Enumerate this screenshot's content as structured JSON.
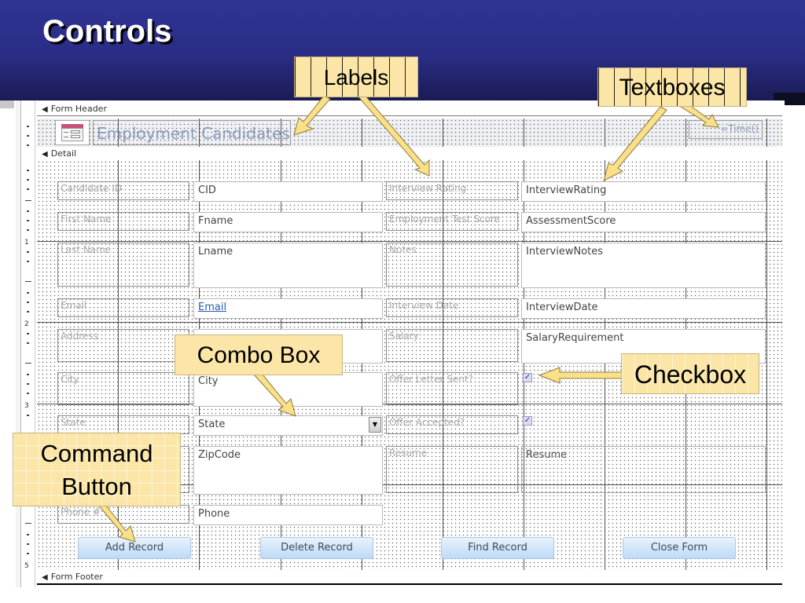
{
  "slide": {
    "title": "Controls"
  },
  "callouts": {
    "labels": "Labels",
    "textboxes": "Textboxes",
    "combo_box": "Combo Box",
    "checkbox": "Checkbox",
    "command_button_line1": "Command",
    "command_button_line2": "Button"
  },
  "designer": {
    "ruler_numbers": [
      "1",
      "2",
      "3",
      "5"
    ],
    "sections": {
      "form_header": "Form Header",
      "detail": "Detail",
      "form_footer": "Form Footer"
    },
    "header": {
      "icon": "form-icon",
      "title": "Employment Candidates",
      "time_expression": "=Time()"
    },
    "left_fields": [
      {
        "label": "Candidate ID",
        "control": "CID",
        "type": "textbox"
      },
      {
        "label": "First Name",
        "control": "Fname",
        "type": "textbox"
      },
      {
        "label": "Last Name",
        "control": "Lname",
        "type": "textbox"
      },
      {
        "label": "Email",
        "control": "Email",
        "type": "hyperlink"
      },
      {
        "label": "Address",
        "control": "",
        "type": "textbox"
      },
      {
        "label": "City",
        "control": "City",
        "type": "textbox"
      },
      {
        "label": "State",
        "control": "State",
        "type": "combobox"
      },
      {
        "label": "",
        "control": "ZipCode",
        "type": "textbox"
      },
      {
        "label": "Phone #",
        "control": "Phone",
        "type": "textbox"
      }
    ],
    "right_fields": [
      {
        "label": "Interview Rating",
        "control": "InterviewRating",
        "type": "textbox"
      },
      {
        "label": "Employment Test Score",
        "control": "AssessmentScore",
        "type": "textbox"
      },
      {
        "label": "Notes",
        "control": "InterviewNotes",
        "type": "textbox"
      },
      {
        "label": "Interview Date",
        "control": "InterviewDate",
        "type": "textbox"
      },
      {
        "label": "Salary",
        "control": "SalaryRequirement",
        "type": "textbox"
      },
      {
        "label": "Offer Letter Sent?",
        "control": "",
        "type": "checkbox",
        "checked": true
      },
      {
        "label": "Offer Accepted?",
        "control": "",
        "type": "checkbox",
        "checked": true
      },
      {
        "label": "Resume",
        "control": "Resume",
        "type": "attachment"
      }
    ],
    "combo_dropdown_icon": "dropdown-arrow-icon",
    "checkbox_mark": "✓",
    "buttons": [
      "Add Record",
      "Delete Record",
      "Find Record",
      "Close Form"
    ]
  },
  "colors": {
    "banner": "#2f3393",
    "callout_fill": "#fbe6a8",
    "button_fill": "#d2e6fa",
    "hyperlink": "#1f5fb0"
  }
}
